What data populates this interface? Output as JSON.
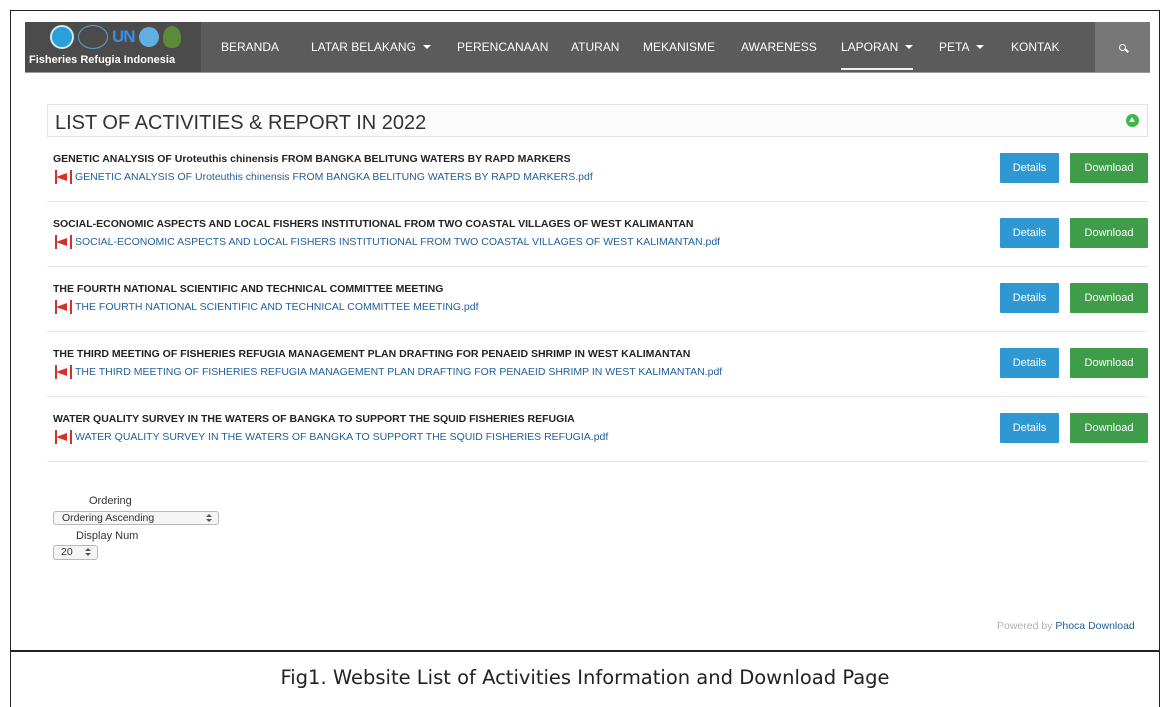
{
  "site": {
    "logo_text": "Fisheries Refugia Indonesia",
    "logo_badges": [
      "seafdec-logo",
      "unep-logo",
      "gef-logo"
    ]
  },
  "nav": {
    "items": [
      {
        "label": "BERANDA",
        "dropdown": false,
        "active": false
      },
      {
        "label": "LATAR BELAKANG",
        "dropdown": true,
        "active": false
      },
      {
        "label": "PERENCANAAN",
        "dropdown": false,
        "active": false
      },
      {
        "label": "ATURAN",
        "dropdown": false,
        "active": false
      },
      {
        "label": "MEKANISME",
        "dropdown": false,
        "active": false
      },
      {
        "label": "AWARENESS",
        "dropdown": false,
        "active": false
      },
      {
        "label": "LAPORAN",
        "dropdown": true,
        "active": true
      },
      {
        "label": "PETA",
        "dropdown": true,
        "active": false
      },
      {
        "label": "KONTAK",
        "dropdown": false,
        "active": false
      }
    ],
    "search_icon": "search-icon"
  },
  "section": {
    "title": "LIST OF ACTIVITIES & REPORT IN 2022",
    "collapse_icon": "arrow-up-circle-icon"
  },
  "files": [
    {
      "title": "GENETIC ANALYSIS OF Uroteuthis chinensis FROM BANGKA BELITUNG WATERS BY RAPD MARKERS",
      "filename": "GENETIC ANALYSIS OF Uroteuthis chinensis FROM BANGKA BELITUNG WATERS BY RAPD MARKERS.pdf"
    },
    {
      "title": "SOCIAL-ECONOMIC ASPECTS AND LOCAL FISHERS INSTITUTIONAL FROM TWO COASTAL VILLAGES OF WEST KALIMANTAN",
      "filename": "SOCIAL-ECONOMIC ASPECTS AND LOCAL FISHERS INSTITUTIONAL FROM TWO COASTAL VILLAGES OF WEST KALIMANTAN.pdf"
    },
    {
      "title": "THE FOURTH NATIONAL SCIENTIFIC AND TECHNICAL COMMITTEE MEETING",
      "filename": "THE FOURTH NATIONAL SCIENTIFIC AND TECHNICAL COMMITTEE MEETING.pdf"
    },
    {
      "title": "THE THIRD MEETING OF FISHERIES REFUGIA MANAGEMENT PLAN DRAFTING FOR PENAEID SHRIMP IN WEST KALIMANTAN",
      "filename": "THE THIRD MEETING OF FISHERIES REFUGIA MANAGEMENT PLAN DRAFTING FOR PENAEID SHRIMP IN WEST KALIMANTAN.pdf"
    },
    {
      "title": "WATER QUALITY SURVEY IN THE WATERS OF BANGKA TO SUPPORT THE SQUID FISHERIES REFUGIA",
      "filename": "WATER QUALITY SURVEY IN THE WATERS OF BANGKA TO SUPPORT THE SQUID FISHERIES REFUGIA.pdf"
    }
  ],
  "buttons": {
    "details": "Details",
    "download": "Download"
  },
  "controls": {
    "ordering_label": "Ordering",
    "ordering_value": "Ordering Ascending",
    "display_label": "Display Num",
    "display_value": "20"
  },
  "footer": {
    "powered_prefix": "Powered by",
    "powered_brand": "Phoca Download"
  },
  "caption": "Fig1. Website List of Activities Information and Download Page",
  "colors": {
    "navbar": "#5b5b5b",
    "details_button": "#2f98d3",
    "download_button": "#3f9c48",
    "link": "#1f5f9a",
    "pdf_icon": "#d3312a"
  }
}
